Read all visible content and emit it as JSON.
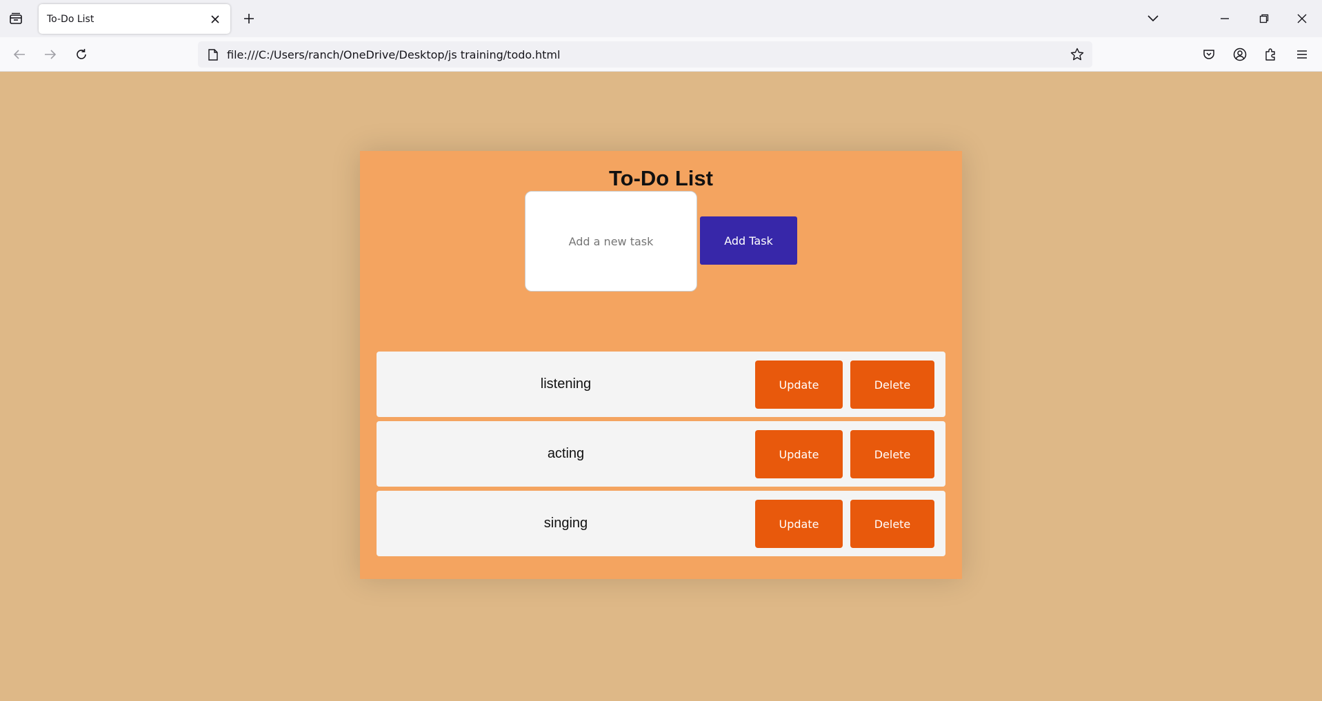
{
  "browser": {
    "tab_title": "To-Do List",
    "url": "file:///C:/Users/ranch/OneDrive/Desktop/js training/todo.html",
    "icons": [
      "tab-list-icon",
      "close-icon",
      "plus-icon",
      "chevron-down-icon",
      "minimize-icon",
      "restore-icon",
      "close-window-icon",
      "back-arrow-icon",
      "forward-arrow-icon",
      "reload-icon",
      "page-icon",
      "star-icon",
      "pocket-icon",
      "account-icon",
      "extensions-icon",
      "menu-icon"
    ]
  },
  "app": {
    "title": "To-Do List",
    "input_placeholder": "Add a new task",
    "input_value": "",
    "add_button_label": "Add Task",
    "tasks": [
      {
        "text": "listening",
        "update_label": "Update",
        "delete_label": "Delete"
      },
      {
        "text": "acting",
        "update_label": "Update",
        "delete_label": "Delete"
      },
      {
        "text": "singing",
        "update_label": "Update",
        "delete_label": "Delete"
      }
    ]
  },
  "colors": {
    "page_background": "#deb887",
    "container_background": "#f4a460",
    "add_button": "#3727a9",
    "action_button": "#e8590c",
    "task_row": "#f4f4f4"
  }
}
